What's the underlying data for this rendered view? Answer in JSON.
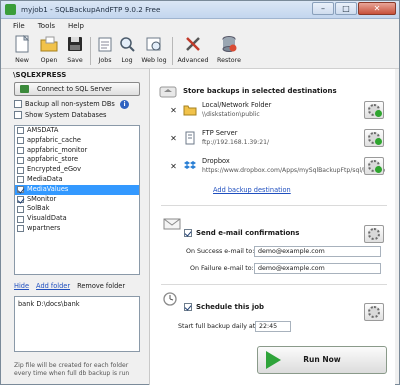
{
  "window": {
    "title": "myjob1 - SQLBackupAndFTP 9.0.2 Free"
  },
  "menu": {
    "items": [
      "File",
      "Tools",
      "Help"
    ]
  },
  "toolbar": {
    "new": "New",
    "open": "Open",
    "save": "Save",
    "jobs": "Jobs",
    "log": "Log",
    "weblog": "Web log",
    "advanced": "Advanced",
    "restore": "Restore"
  },
  "left": {
    "server": "\\SQLEXPRESS",
    "connect_label": "Connect to SQL Server",
    "backup_all_label": "Backup all non-system DBs",
    "show_system_label": "Show System Databases",
    "databases": [
      {
        "name": "AMSDATA",
        "checked": false,
        "selected": false
      },
      {
        "name": "appfabric_cache",
        "checked": false,
        "selected": false
      },
      {
        "name": "appfabric_monitor",
        "checked": false,
        "selected": false
      },
      {
        "name": "appfabric_store",
        "checked": false,
        "selected": false
      },
      {
        "name": "Encrypted_eGov",
        "checked": false,
        "selected": false
      },
      {
        "name": "MediaData",
        "checked": false,
        "selected": false
      },
      {
        "name": "MediaValues",
        "checked": true,
        "selected": true
      },
      {
        "name": "SMonitor",
        "checked": true,
        "selected": false
      },
      {
        "name": "SolBak",
        "checked": false,
        "selected": false
      },
      {
        "name": "VisualdData",
        "checked": false,
        "selected": false
      },
      {
        "name": "wpartners",
        "checked": false,
        "selected": false
      }
    ],
    "hide_link": "Hide",
    "add_folder_link": "Add folder",
    "remove_folder": "Remove folder",
    "folder_entry": "bank   D:\\docs\\bank",
    "zip_note": "Zip file will be created for each folder every time when full db backup is run"
  },
  "right": {
    "store_header": "Store backups in selected destinations",
    "destinations": [
      {
        "name": "Local/Network Folder",
        "path": "\\\\diskstation\\public"
      },
      {
        "name": "FTP Server",
        "path": "ftp://192.168.1.39:21/"
      },
      {
        "name": "Dropbox",
        "path": "https://www.dropbox.com/Apps/mySqlBackupFtp/sql/backup"
      }
    ],
    "add_destination": "Add backup destination",
    "email_header": "Send e-mail confirmations",
    "on_success_label": "On Success e-mail to:",
    "on_success_value": "demo@example.com",
    "on_failure_label": "On Failure e-mail to:",
    "on_failure_value": "demo@example.com",
    "schedule_header": "Schedule this job",
    "start_label": "Start full backup daily at:",
    "start_time": "22:45",
    "run_now": "Run Now"
  },
  "colors": {
    "selection": "#3399ff",
    "link": "#1f4fbf",
    "run_arrow": "#2fa43a"
  }
}
